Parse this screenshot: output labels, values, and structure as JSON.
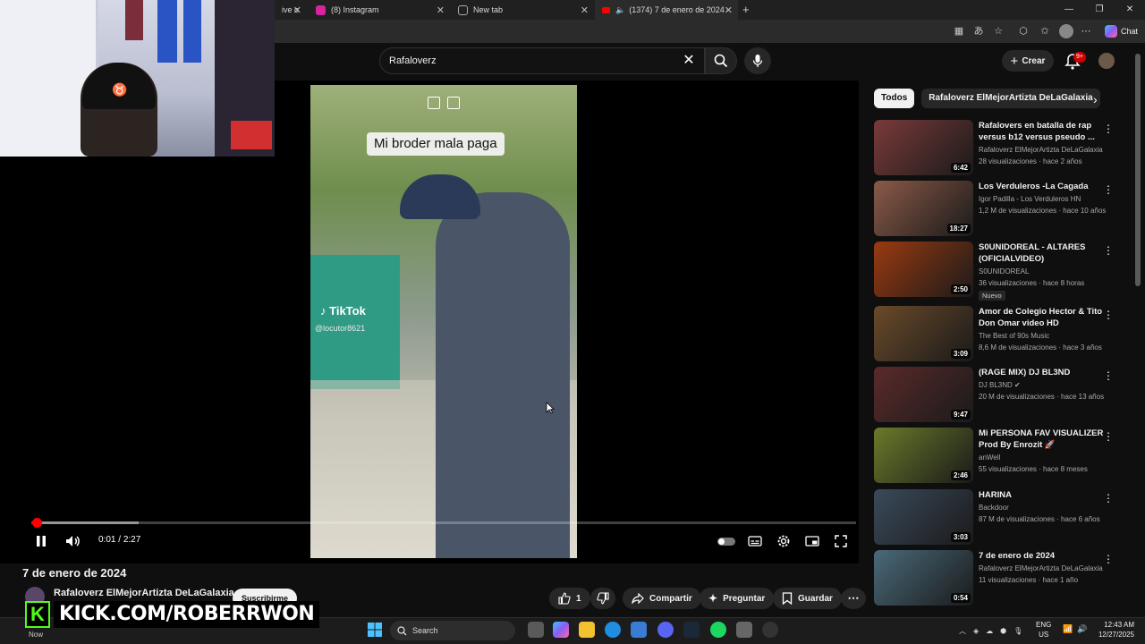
{
  "browser": {
    "tabs": [
      {
        "label": "ive o",
        "color": "#555555"
      },
      {
        "label": "(8) Instagram",
        "color": "#d6249f"
      },
      {
        "label": "New tab",
        "color": "#888888"
      },
      {
        "label": "(1374) 7 de enero de 2024 -",
        "color": "#ff0000"
      }
    ],
    "chat_label": "Chat"
  },
  "youtube": {
    "search_value": "Rafaloverz",
    "create_label": "Crear",
    "notif_badge": "9+"
  },
  "player": {
    "caption": "Mi broder mala paga",
    "tiktok_brand": "TikTok",
    "tiktok_user": "@locutor8621",
    "current_time": "0:01",
    "separator": "/",
    "duration": "2:27",
    "progress_fraction": 0.007,
    "buffer_fraction": 0.13
  },
  "video": {
    "title": "7 de enero de 2024",
    "channel": "Rafaloverz ElMejorArtizta DeLaGalaxia",
    "subscribe_label": "Suscribirme",
    "likes": "1",
    "share_label": "Compartir",
    "ask_label": "Preguntar",
    "save_label": "Guardar"
  },
  "sidebar": {
    "chips": [
      "Todos",
      "Rafaloverz ElMejorArtizta DeLaGalaxia"
    ],
    "items": [
      {
        "title": "Rafalovers en batalla de rap versus b12 versus pseudo ...",
        "channel": "Rafaloverz ElMejorArtizta DeLaGalaxia",
        "meta": "28 visualizaciones · hace 2 años",
        "duration": "6:42",
        "badge": "",
        "color": "#7a3a3a"
      },
      {
        "title": "Los Verduleros -La Cagada",
        "channel": "Igor Padilla - Los Verduleros HN",
        "meta": "1,2 M de visualizaciones · hace 10 años",
        "duration": "18:27",
        "badge": "",
        "color": "#8a5a48"
      },
      {
        "title": "S0UNIDOREAL  - ALTARES (OFICIALVIDEO)",
        "channel": "S0UNIDOREAL",
        "meta": "36 visualizaciones · hace 8 horas",
        "duration": "2:50",
        "badge": "Nuevo",
        "color": "#9a3a10"
      },
      {
        "title": "Amor de Colegio Hector & Tito Don Omar video HD",
        "channel": "The Best of 90s Music",
        "meta": "8,6 M de visualizaciones · hace 3 años",
        "duration": "3:09",
        "badge": "",
        "color": "#6a4a2a"
      },
      {
        "title": "(RAGE MIX) DJ BL3ND",
        "channel": "DJ BL3ND",
        "meta": "20 M de visualizaciones · hace 13 años",
        "duration": "9:47",
        "badge": "",
        "color": "#5a2a2a"
      },
      {
        "title": "Mi PERSONA FAV VISUALIZER Prod By Enrozit 🚀",
        "channel": "anWell",
        "meta": "55 visualizaciones · hace 8 meses",
        "duration": "2:46",
        "badge": "",
        "color": "#6a7a2a"
      },
      {
        "title": "HARINA",
        "channel": "Backdoor",
        "meta": "87 M de visualizaciones · hace 6 años",
        "duration": "3:03",
        "badge": "",
        "color": "#3a4a5a"
      },
      {
        "title": "7 de enero de 2024",
        "channel": "Rafaloverz ElMejorArtizta DeLaGalaxia",
        "meta": "11 visualizaciones · hace 1 año",
        "duration": "0:54",
        "badge": "",
        "color": "#4a6a7a"
      }
    ]
  },
  "overlay": {
    "kick_letter": "K",
    "kick_text": "KICK.COM/ROBERRWON"
  },
  "taskbar": {
    "search_label": "Search",
    "lang_top": "ENG",
    "lang_bottom": "US",
    "time": "12:43 AM",
    "date": "12/27/2025",
    "now_label": "Now"
  }
}
